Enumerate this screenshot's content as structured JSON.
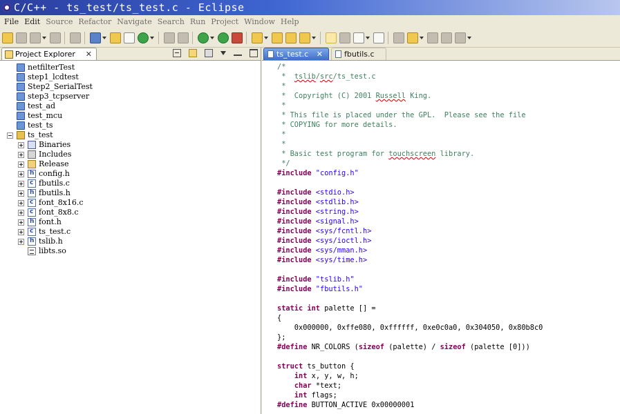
{
  "window": {
    "title": "C/C++ - ts_test/ts_test.c - Eclipse"
  },
  "menu": [
    {
      "label": "File",
      "enabled": true
    },
    {
      "label": "Edit",
      "enabled": true
    },
    {
      "label": "Source",
      "enabled": false
    },
    {
      "label": "Refactor",
      "enabled": false
    },
    {
      "label": "Navigate",
      "enabled": false
    },
    {
      "label": "Search",
      "enabled": false
    },
    {
      "label": "Run",
      "enabled": false
    },
    {
      "label": "Project",
      "enabled": false
    },
    {
      "label": "Window",
      "enabled": false
    },
    {
      "label": "Help",
      "enabled": false
    }
  ],
  "toolbar_icons": [
    "new-icon",
    "save-icon",
    "save-all-icon",
    "print-icon",
    "build-icon",
    "new-class-icon",
    "new-folder-icon",
    "new-source-icon",
    "new-wizard-icon",
    "hammer-build-icon",
    "build-config-icon",
    "debug-icon",
    "run-icon",
    "external-tools-icon",
    "open-type-icon",
    "open-element-icon",
    "open-folder-icon",
    "search-icon",
    "highlight-icon",
    "mark-icon",
    "toggle-block-icon",
    "show-whitespace-icon",
    "next-annotation-icon",
    "prev-annotation-icon",
    "last-edit-icon",
    "back-icon",
    "forward-icon"
  ],
  "explorer": {
    "tab_label": "Project Explorer",
    "close_symbol": "✕",
    "tree": [
      {
        "label": "netfilterTest",
        "icon": "folder",
        "depth": 0
      },
      {
        "label": "step1_lcdtest",
        "icon": "folder",
        "depth": 0
      },
      {
        "label": "Step2_SerialTest",
        "icon": "folder",
        "depth": 0
      },
      {
        "label": "step3_tcpserver",
        "icon": "folder",
        "depth": 0
      },
      {
        "label": "test_ad",
        "icon": "folder",
        "depth": 0
      },
      {
        "label": "test_mcu",
        "icon": "folder",
        "depth": 0
      },
      {
        "label": "test_ts",
        "icon": "folder",
        "depth": 0
      },
      {
        "label": "ts_test",
        "icon": "project",
        "depth": 0,
        "expander": "minus"
      },
      {
        "label": "Binaries",
        "icon": "binaries",
        "depth": 1,
        "expander": "plus"
      },
      {
        "label": "Includes",
        "icon": "includes",
        "depth": 1,
        "expander": "plus"
      },
      {
        "label": "Release",
        "icon": "release",
        "depth": 1,
        "expander": "plus"
      },
      {
        "label": "config.h",
        "icon": "hfile",
        "depth": 1,
        "expander": "plus"
      },
      {
        "label": "fbutils.c",
        "icon": "cfile",
        "depth": 1,
        "expander": "plus"
      },
      {
        "label": "fbutils.h",
        "icon": "hfile",
        "depth": 1,
        "expander": "plus"
      },
      {
        "label": "font_8x16.c",
        "icon": "cfile",
        "depth": 1,
        "expander": "plus"
      },
      {
        "label": "font_8x8.c",
        "icon": "cfile",
        "depth": 1,
        "expander": "plus"
      },
      {
        "label": "font.h",
        "icon": "hfile",
        "depth": 1,
        "expander": "plus"
      },
      {
        "label": "ts_test.c",
        "icon": "cfile",
        "depth": 1,
        "expander": "plus"
      },
      {
        "label": "tslib.h",
        "icon": "hfile",
        "depth": 1,
        "expander": "plus"
      },
      {
        "label": "libts.so",
        "icon": "lib",
        "depth": 1
      }
    ]
  },
  "editor": {
    "tabs": [
      {
        "label": "ts_test.c",
        "active": true,
        "close_symbol": "✕"
      },
      {
        "label": "fbutils.c",
        "active": false
      }
    ],
    "code": [
      [
        {
          "t": "/*",
          "c": "cm"
        }
      ],
      [
        {
          "t": " *  ",
          "c": "cm"
        },
        {
          "t": "tslib",
          "c": "cm sq"
        },
        {
          "t": "/",
          "c": "cm"
        },
        {
          "t": "src",
          "c": "cm sq"
        },
        {
          "t": "/ts_test.c",
          "c": "cm"
        }
      ],
      [
        {
          "t": " *",
          "c": "cm"
        }
      ],
      [
        {
          "t": " *  Copyright (C) 2001 ",
          "c": "cm"
        },
        {
          "t": "Russell",
          "c": "cm sq"
        },
        {
          "t": " King.",
          "c": "cm"
        }
      ],
      [
        {
          "t": " *",
          "c": "cm"
        }
      ],
      [
        {
          "t": " * This file is placed under the GPL.  Please see the file",
          "c": "cm"
        }
      ],
      [
        {
          "t": " * COPYING for more details.",
          "c": "cm"
        }
      ],
      [
        {
          "t": " *",
          "c": "cm"
        }
      ],
      [
        {
          "t": " *",
          "c": "cm"
        }
      ],
      [
        {
          "t": " * Basic test program for ",
          "c": "cm"
        },
        {
          "t": "touchscreen",
          "c": "cm sq"
        },
        {
          "t": " library.",
          "c": "cm"
        }
      ],
      [
        {
          "t": " */",
          "c": "cm"
        }
      ],
      [
        {
          "t": "#include ",
          "c": "kw"
        },
        {
          "t": "\"config.h\"",
          "c": "st"
        }
      ],
      [],
      [
        {
          "t": "#include ",
          "c": "kw"
        },
        {
          "t": "<stdio.h>",
          "c": "st"
        }
      ],
      [
        {
          "t": "#include ",
          "c": "kw"
        },
        {
          "t": "<stdlib.h>",
          "c": "st"
        }
      ],
      [
        {
          "t": "#include ",
          "c": "kw"
        },
        {
          "t": "<string.h>",
          "c": "st"
        }
      ],
      [
        {
          "t": "#include ",
          "c": "kw"
        },
        {
          "t": "<signal.h>",
          "c": "st"
        }
      ],
      [
        {
          "t": "#include ",
          "c": "kw"
        },
        {
          "t": "<sys/fcntl.h>",
          "c": "st"
        }
      ],
      [
        {
          "t": "#include ",
          "c": "kw"
        },
        {
          "t": "<sys/ioctl.h>",
          "c": "st"
        }
      ],
      [
        {
          "t": "#include ",
          "c": "kw"
        },
        {
          "t": "<sys/mman.h>",
          "c": "st"
        }
      ],
      [
        {
          "t": "#include ",
          "c": "kw"
        },
        {
          "t": "<sys/time.h>",
          "c": "st"
        }
      ],
      [],
      [
        {
          "t": "#include ",
          "c": "kw"
        },
        {
          "t": "\"tslib.h\"",
          "c": "st"
        }
      ],
      [
        {
          "t": "#include ",
          "c": "kw"
        },
        {
          "t": "\"fbutils.h\"",
          "c": "st"
        }
      ],
      [],
      [
        {
          "t": "static int",
          "c": "kw"
        },
        {
          "t": " palette [] =",
          "c": ""
        }
      ],
      [
        {
          "t": "{",
          "c": ""
        }
      ],
      [
        {
          "t": "    0x000000, 0xffe080, 0xffffff, 0xe0c0a0, 0x304050, 0x80b8c0",
          "c": ""
        }
      ],
      [
        {
          "t": "};",
          "c": ""
        }
      ],
      [
        {
          "t": "#define",
          "c": "kw"
        },
        {
          "t": " NR_COLORS (",
          "c": ""
        },
        {
          "t": "sizeof",
          "c": "kw"
        },
        {
          "t": " (palette) / ",
          "c": ""
        },
        {
          "t": "sizeof",
          "c": "kw"
        },
        {
          "t": " (palette [0]))",
          "c": ""
        }
      ],
      [],
      [
        {
          "t": "struct",
          "c": "kw"
        },
        {
          "t": " ts_button {",
          "c": ""
        }
      ],
      [
        {
          "t": "    ",
          "c": ""
        },
        {
          "t": "int",
          "c": "kw"
        },
        {
          "t": " x, y, w, h;",
          "c": ""
        }
      ],
      [
        {
          "t": "    ",
          "c": ""
        },
        {
          "t": "char",
          "c": "kw"
        },
        {
          "t": " *text;",
          "c": ""
        }
      ],
      [
        {
          "t": "    ",
          "c": ""
        },
        {
          "t": "int",
          "c": "kw"
        },
        {
          "t": " flags;",
          "c": ""
        }
      ],
      [
        {
          "t": "#define",
          "c": "kw"
        },
        {
          "t": " BUTTON_ACTIVE 0x00000001",
          "c": ""
        }
      ]
    ]
  }
}
